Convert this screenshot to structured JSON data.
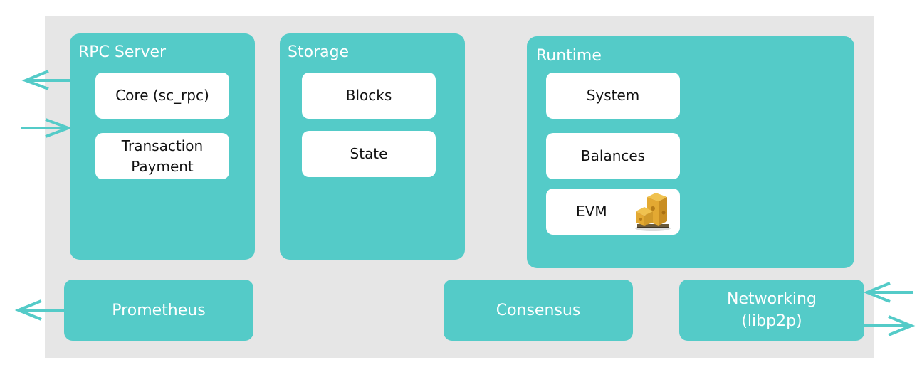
{
  "diagram": {
    "colors": {
      "accent": "#54cbc8",
      "background": "#e6e6e6",
      "card": "#ffffff"
    },
    "rpc_server": {
      "title": "RPC Server",
      "items": [
        "Core (sc_rpc)",
        "Transaction\nPayment"
      ]
    },
    "storage": {
      "title": "Storage",
      "items": [
        "Blocks",
        "State"
      ]
    },
    "runtime": {
      "title": "Runtime",
      "items": [
        "System",
        "Balances",
        "EVM"
      ],
      "evm_icon": "pallet-boxes-icon"
    },
    "bottom": {
      "prometheus": "Prometheus",
      "consensus": "Consensus",
      "networking": "Networking\n(libp2p)"
    },
    "arrows": [
      {
        "from": "rpc-server",
        "direction": "out"
      },
      {
        "to": "rpc-server",
        "direction": "in"
      },
      {
        "from": "prometheus",
        "direction": "out"
      },
      {
        "to": "networking",
        "direction": "in"
      },
      {
        "from": "networking",
        "direction": "out"
      }
    ]
  }
}
